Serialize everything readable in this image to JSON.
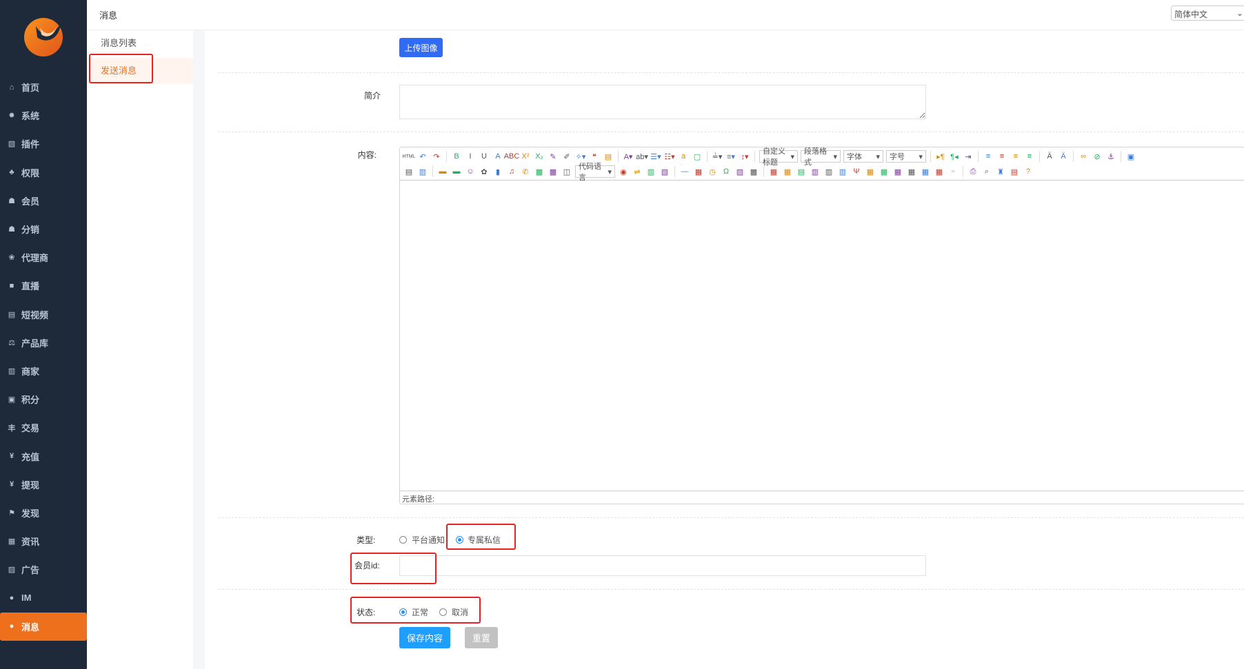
{
  "sidebar": {
    "items": [
      {
        "label": "首页",
        "icon": "home-icon",
        "glyph": "⌂"
      },
      {
        "label": "系统",
        "icon": "gear-icon",
        "glyph": "✹"
      },
      {
        "label": "插件",
        "icon": "plugin-icon",
        "glyph": "▧"
      },
      {
        "label": "权限",
        "icon": "sitemap-icon",
        "glyph": "♣"
      },
      {
        "label": "会员",
        "icon": "users-icon",
        "glyph": "☗"
      },
      {
        "label": "分销",
        "icon": "users-icon",
        "glyph": "☗"
      },
      {
        "label": "代理商",
        "icon": "cubes-icon",
        "glyph": "❀"
      },
      {
        "label": "直播",
        "icon": "video-icon",
        "glyph": "■"
      },
      {
        "label": "短视频",
        "icon": "file-video-icon",
        "glyph": "▤"
      },
      {
        "label": "产品库",
        "icon": "balance-scale-icon",
        "glyph": "⚖"
      },
      {
        "label": "商家",
        "icon": "bank-icon",
        "glyph": "▥"
      },
      {
        "label": "积分",
        "icon": "file-points-icon",
        "glyph": "▣"
      },
      {
        "label": "交易",
        "icon": "yen-sign-icon",
        "glyph": "丰"
      },
      {
        "label": "充值",
        "icon": "yen-icon",
        "glyph": "¥"
      },
      {
        "label": "提现",
        "icon": "yen-icon",
        "glyph": "¥"
      },
      {
        "label": "发现",
        "icon": "flag-icon",
        "glyph": "⚑"
      },
      {
        "label": "资讯",
        "icon": "newspaper-icon",
        "glyph": "▦"
      },
      {
        "label": "广告",
        "icon": "image-icon",
        "glyph": "▨"
      },
      {
        "label": "IM",
        "icon": "comments-icon",
        "glyph": "●"
      },
      {
        "label": "消息",
        "icon": "comment-icon",
        "glyph": "●",
        "active": true
      }
    ]
  },
  "header": {
    "title": "消息",
    "language": "简体中文"
  },
  "submenu": {
    "items": [
      {
        "label": "消息列表"
      },
      {
        "label": "发送消息",
        "active": true
      }
    ]
  },
  "form": {
    "upload_button": "上传图像",
    "intro_label": "简介",
    "intro_value": "",
    "content_label": "内容:",
    "editor": {
      "row1": [
        "HTML",
        "↶",
        "↷",
        "|",
        "B",
        "I",
        "U",
        "A",
        "ABC",
        "X²",
        "X₂",
        "✎",
        "✐",
        "✧▾",
        "❝",
        "▤",
        "|",
        "A▾",
        "ab▾",
        "☰▾",
        "☷▾",
        "a",
        "▢",
        "|",
        "≟▾",
        "≡▾",
        "↕▾",
        "|",
        "SEL:custom_heading",
        "SEL:paragraph",
        "SEL:font",
        "SEL:size",
        "|",
        "▸¶",
        "¶◂",
        "⇥",
        "|",
        "≡",
        "≡",
        "≡",
        "≡",
        "|",
        "Ä",
        "Ä",
        "|",
        "∞",
        "⊘",
        "⚓",
        "|",
        "▣"
      ],
      "row2": [
        "▤",
        "▥",
        "|",
        "▬",
        "▬",
        "☺",
        "✿",
        "▮",
        "♫",
        "✆",
        "▩",
        "▩",
        "◫",
        "SEL:code",
        "◉",
        "⇌",
        "▥",
        "▧",
        "|",
        "—",
        "▦",
        "◷",
        "Ω",
        "▨",
        "▩",
        "|",
        "▦",
        "▦",
        "▤",
        "▥",
        "▥",
        "▥",
        "Ψ",
        "▦",
        "▦",
        "▦",
        "▦",
        "▦",
        "▦",
        "▫",
        "|",
        "⎙",
        "⌕",
        "♜",
        "▤",
        "?"
      ],
      "custom_heading": "自定义标题",
      "paragraph": "段落格式",
      "font": "字体",
      "size": "字号",
      "code": "代码语言",
      "status_path": "元素路径:"
    },
    "type_label": "类型:",
    "type_options": [
      {
        "label": "平台通知",
        "checked": false
      },
      {
        "label": "专属私信",
        "checked": true
      }
    ],
    "member_id_label": "会员id:",
    "member_id_value": "",
    "status_label": "状态:",
    "status_options": [
      {
        "label": "正常",
        "checked": true
      },
      {
        "label": "取消",
        "checked": false
      }
    ],
    "save_button": "保存内容",
    "reset_button": "重置"
  },
  "colors": {
    "sidebar_bg": "#1e2a3a",
    "accent": "#ee6f1c",
    "primary": "#1e9fff",
    "upload": "#2f6bf5",
    "highlight": "#e8231f"
  }
}
